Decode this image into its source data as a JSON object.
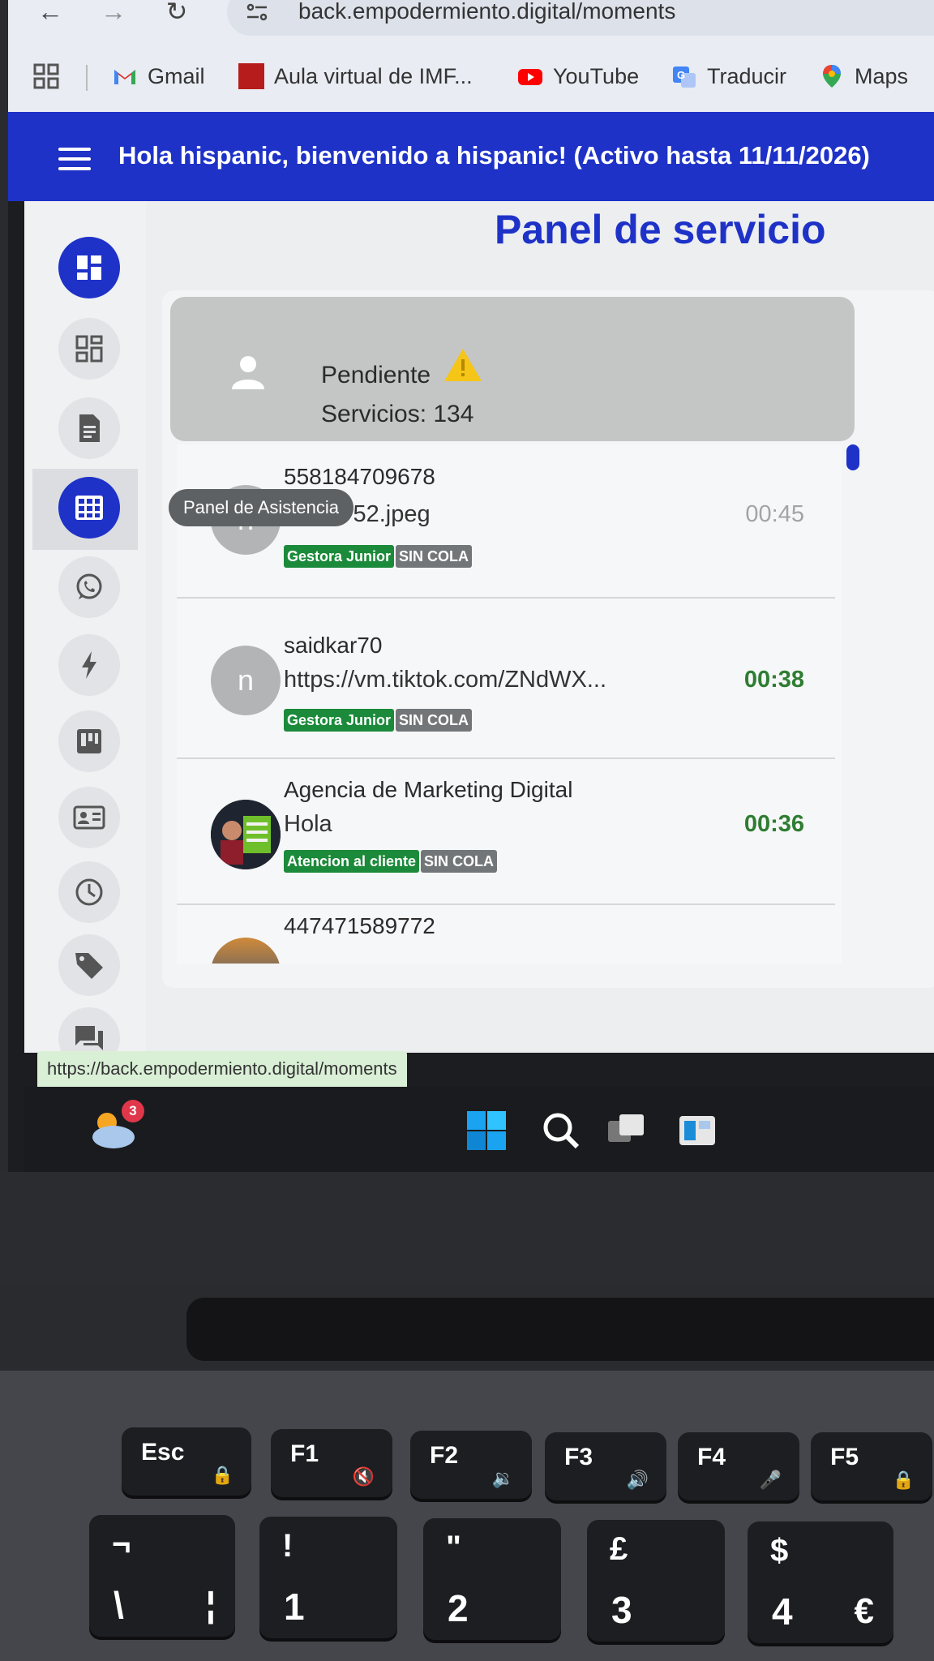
{
  "browser": {
    "url": "back.empodermiento.digital/moments",
    "bookmarks": [
      {
        "label": "Gmail",
        "icon": "gmail-icon"
      },
      {
        "label": "Aula virtual de IMF...",
        "icon": "imf-icon"
      },
      {
        "label": "YouTube",
        "icon": "youtube-icon"
      },
      {
        "label": "Traducir",
        "icon": "translate-icon"
      },
      {
        "label": "Maps",
        "icon": "maps-icon"
      }
    ],
    "status_url": "https://back.empodermiento.digital/moments"
  },
  "banner": {
    "text": "Hola hispanic, bienvenido a hispanic! (Activo hasta 11/11/2026)"
  },
  "sidebar": {
    "tooltip": "Panel de Asistencia",
    "items": [
      "dashboard",
      "qr-grid",
      "document",
      "attendance-grid",
      "whatsapp",
      "flash",
      "kanban",
      "contact-card",
      "clock",
      "tag",
      "chat"
    ]
  },
  "page": {
    "title": "Panel de servicio"
  },
  "queue": {
    "status_label": "Pendiente",
    "count_label": "Servicios: 134"
  },
  "conversations": [
    {
      "name": "558184709678",
      "message": "file_3752.jpeg",
      "time": "00:45",
      "avatar_letter": "n",
      "tags": [
        {
          "label": "Gestora Junior",
          "color": "green"
        },
        {
          "label": "SIN COLA",
          "color": "grey"
        }
      ]
    },
    {
      "name": "saidkar70",
      "message": "https://vm.tiktok.com/ZNdWX...",
      "time": "00:38",
      "avatar_letter": "n",
      "tags": [
        {
          "label": "Gestora Junior",
          "color": "green"
        },
        {
          "label": "SIN COLA",
          "color": "grey"
        }
      ]
    },
    {
      "name": "Agencia de Marketing Digital",
      "message": "Hola",
      "time": "00:36",
      "avatar_letter": "",
      "tags": [
        {
          "label": "Atencion al cliente",
          "color": "green"
        },
        {
          "label": "SIN COLA",
          "color": "grey"
        }
      ]
    },
    {
      "name": "447471589772",
      "message": "",
      "time": "",
      "avatar_letter": "",
      "tags": []
    }
  ],
  "taskbar": {
    "weather_badge": "3"
  },
  "keyboard": {
    "function_keys": [
      "Esc",
      "F1",
      "F2",
      "F3",
      "F4",
      "F5"
    ],
    "number_keys": [
      {
        "top": "¬",
        "main": "\\",
        "alt": "¦"
      },
      {
        "top": "!",
        "main": "1",
        "alt": ""
      },
      {
        "top": "\"",
        "main": "2",
        "alt": ""
      },
      {
        "top": "£",
        "main": "3",
        "alt": ""
      },
      {
        "top": "$",
        "main": "4",
        "alt": "€"
      }
    ]
  },
  "colors": {
    "brand": "#1e32c8",
    "time_active": "#2e7d32",
    "tag_green": "#1b8a3a",
    "tag_grey": "#737678"
  }
}
